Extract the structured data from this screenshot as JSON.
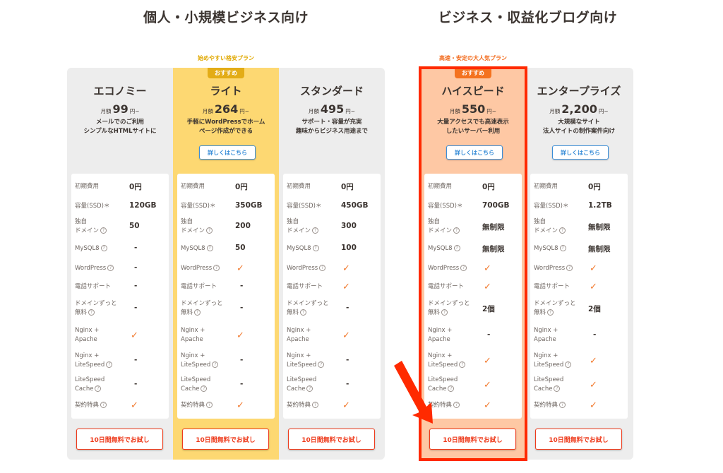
{
  "groups": [
    {
      "title": "個人・小規模ビジネス向け",
      "plans": [
        {
          "name": "エコノミー",
          "price_prefix": "月額",
          "price": "99",
          "price_suffix": "円~",
          "desc": [
            "メールでのご利用",
            "シンプルなHTMLサイトに"
          ],
          "detail_button": null,
          "badge": null,
          "tagline": null
        },
        {
          "name": "ライト",
          "price_prefix": "月額",
          "price": "264",
          "price_suffix": "円~",
          "desc": [
            "手軽にWordPressでホーム",
            "ページ作成ができる"
          ],
          "detail_button": "詳しくはこちら",
          "badge": "おすすめ",
          "tagline": "始めやすい格安プラン"
        },
        {
          "name": "スタンダード",
          "price_prefix": "月額",
          "price": "495",
          "price_suffix": "円~",
          "desc": [
            "サポート・容量が充実",
            "趣味からビジネス用途まで"
          ],
          "detail_button": null,
          "badge": null,
          "tagline": null
        }
      ]
    },
    {
      "title": "ビジネス・収益化ブログ向け",
      "plans": [
        {
          "name": "ハイスピード",
          "price_prefix": "月額",
          "price": "550",
          "price_suffix": "円~",
          "desc": [
            "大量アクセスでも高速表示",
            "したいサーバー利用"
          ],
          "detail_button": "詳しくはこちら",
          "badge": "おすすめ",
          "tagline": "高速・安定の大人気プラン"
        },
        {
          "name": "エンタープライズ",
          "price_prefix": "月額",
          "price": "2,200",
          "price_suffix": "円~",
          "desc": [
            "大規模なサイト",
            "法人サイトの制作案件向け"
          ],
          "detail_button": "詳しくはこちら",
          "badge": null,
          "tagline": null
        }
      ]
    }
  ],
  "spec_labels": [
    {
      "lines": [
        "初期費用"
      ],
      "help": false
    },
    {
      "lines": [
        "容量(SSD)＊"
      ],
      "help": false
    },
    {
      "lines": [
        "独自",
        "ドメイン"
      ],
      "help": true
    },
    {
      "lines": [
        "MySQL8"
      ],
      "help": true
    },
    {
      "lines": [
        "WordPress"
      ],
      "help": true
    },
    {
      "lines": [
        "電話サポート"
      ],
      "help": false
    },
    {
      "lines": [
        "ドメインずっと",
        "無料"
      ],
      "help": true
    },
    {
      "lines": [
        "Nginx +",
        "Apache"
      ],
      "help": false
    },
    {
      "lines": [
        "Nginx +",
        "LiteSpeed"
      ],
      "help": true
    },
    {
      "lines": [
        "LiteSpeed",
        "Cache"
      ],
      "help": true
    },
    {
      "lines": [
        "契約特典"
      ],
      "help": true
    }
  ],
  "spec_values": [
    [
      "0円",
      "120GB",
      "50",
      "-",
      "-",
      "-",
      "-",
      "check",
      "-",
      "-",
      "check"
    ],
    [
      "0円",
      "350GB",
      "200",
      "50",
      "check",
      "-",
      "-",
      "check",
      "-",
      "-",
      "check"
    ],
    [
      "0円",
      "450GB",
      "300",
      "100",
      "check",
      "check",
      "-",
      "check",
      "-",
      "-",
      "check"
    ],
    [
      "0円",
      "700GB",
      "無制限",
      "無制限",
      "check",
      "check",
      "2個",
      "-",
      "check",
      "check",
      "check"
    ],
    [
      "0円",
      "1.2TB",
      "無制限",
      "無制限",
      "check",
      "check",
      "2個",
      "-",
      "check",
      "check",
      "check"
    ]
  ],
  "trial_button": "10日間無料でお試し",
  "help_icon": "?",
  "check_icon": "✓",
  "colors": {
    "light_bg": "#fdd872",
    "hispeed_bg": "#fec8a4",
    "highlight_frame": "#ff2a00",
    "accent_orange": "#f27a2f",
    "link_blue": "#3a8ed8"
  }
}
